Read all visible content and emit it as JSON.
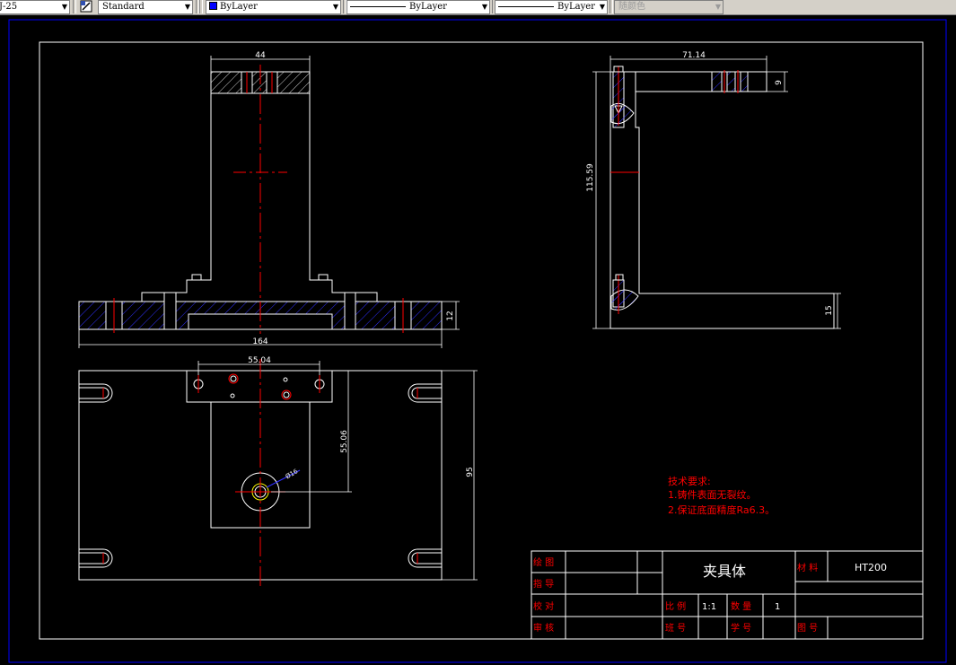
{
  "toolbar": {
    "dimstyle": "J-25",
    "textstyle": "Standard",
    "color": "ByLayer",
    "linetype": "ByLayer",
    "lineweight": "ByLayer",
    "plotstyle": "随颜色",
    "color_swatch": "#0000ff"
  },
  "drawing": {
    "dims": {
      "d44": "44",
      "d164": "164",
      "d12": "12",
      "d5504": "55.04",
      "d5506": "55.06",
      "d95": "95",
      "phi16": "Ø16",
      "d7114": "71.14",
      "d9": "9",
      "d11559": "115.59",
      "d15": "15"
    },
    "notes": {
      "title": "技术要求:",
      "line1": "1.铸件表面无裂纹。",
      "line2": "2.保证底面精度Ra6.3。"
    },
    "titleblock": {
      "huitu": "绘 图",
      "zhidao": "指 导",
      "jiaodui": "校 对",
      "shenhe": "审 核",
      "name": "夹具体",
      "material_label": "材 料",
      "material": "HT200",
      "scale_label": "比 例",
      "scale": "1:1",
      "qty_label": "数 量",
      "qty": "1",
      "class_label": "班 号",
      "student_label": "学 号",
      "drawing_no_label": "图 号"
    }
  },
  "colors": {
    "line": "#ffffff",
    "center": "#ff0000",
    "hatch": "#3030ff",
    "dim": "#ffffff",
    "frame": "#0000ff",
    "note": "#ff0000"
  }
}
